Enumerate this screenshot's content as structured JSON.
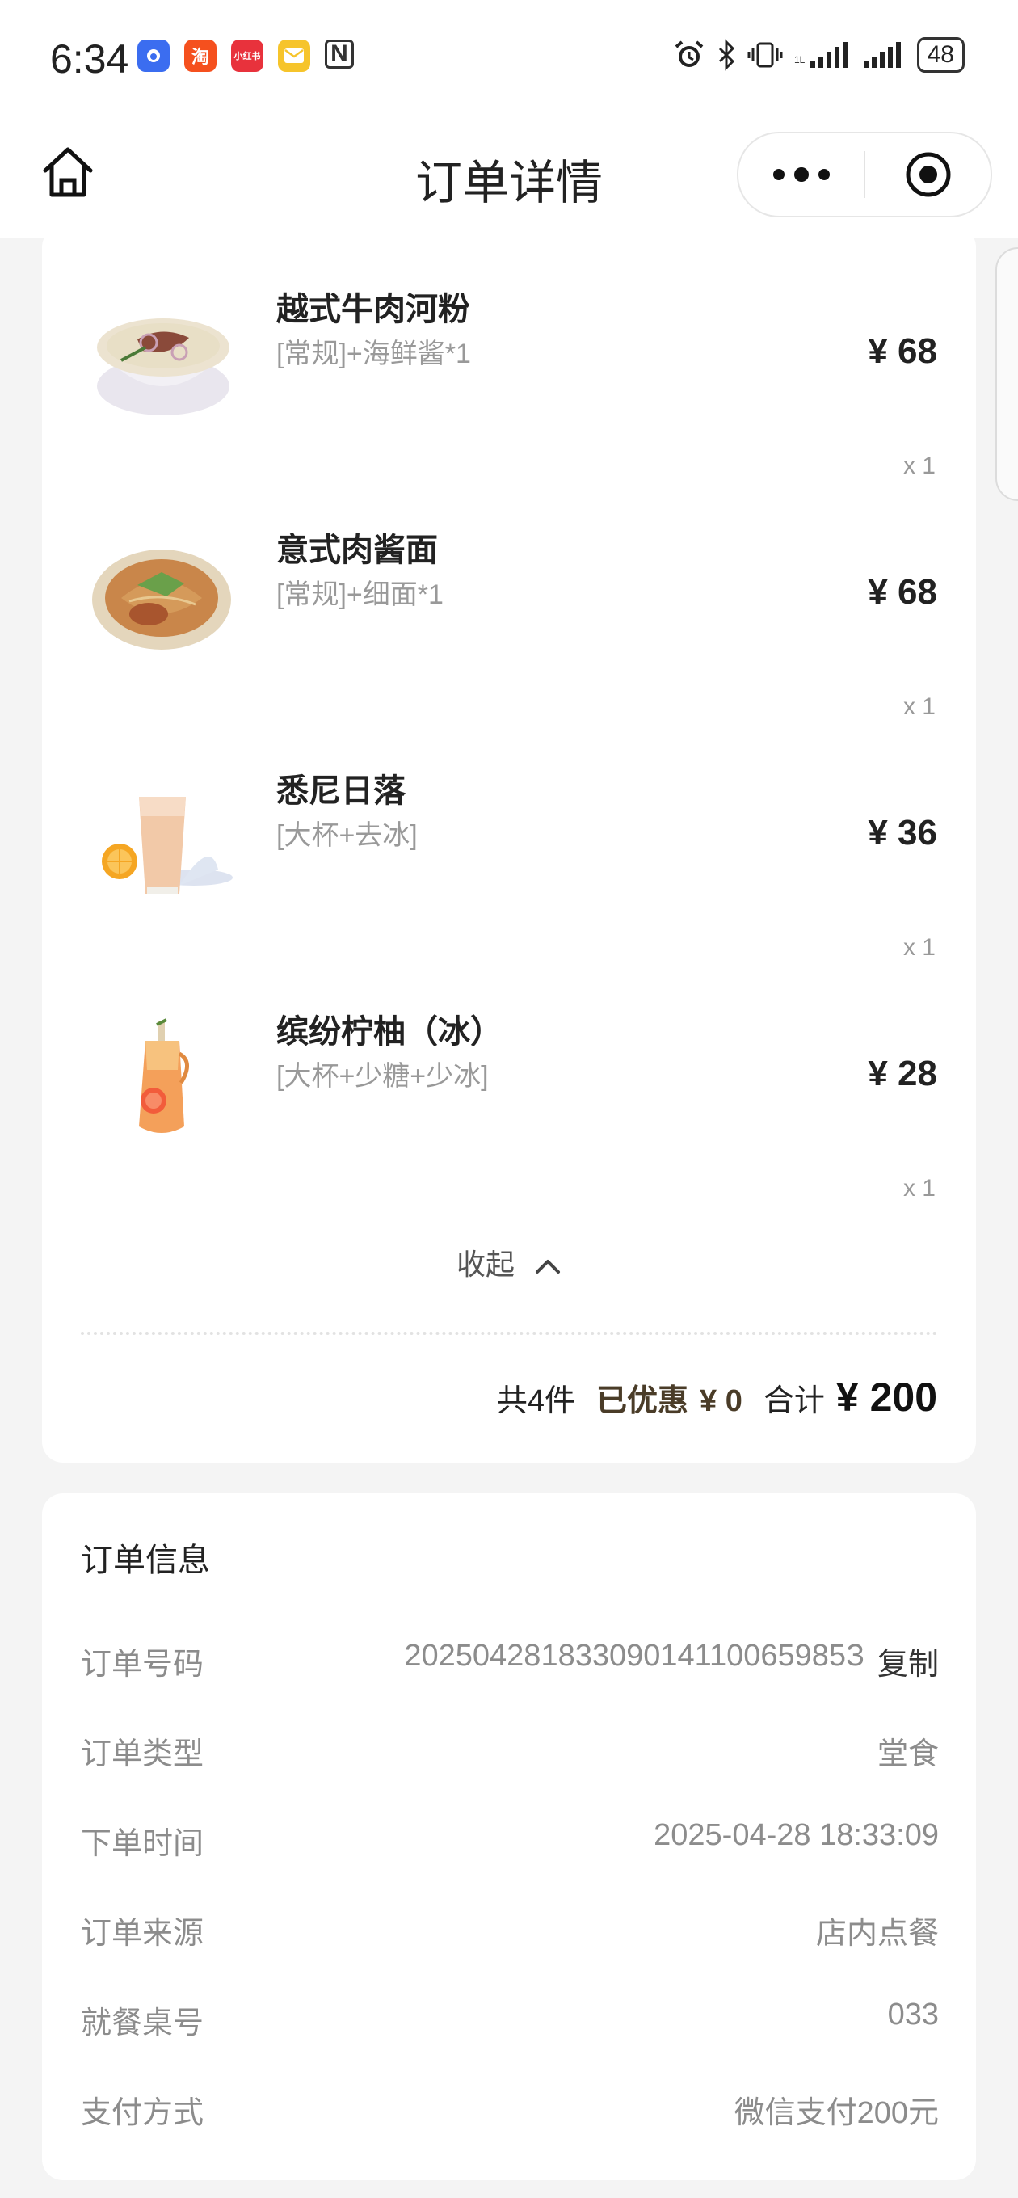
{
  "status_bar": {
    "time": "6:34",
    "battery": "48",
    "app_icons": [
      {
        "icon": "baidu-icon",
        "color": "#3b6df0",
        "label": ""
      },
      {
        "icon": "taobao-icon",
        "color": "#f5501e",
        "label": "淘"
      },
      {
        "icon": "xiaohongshu-icon",
        "color": "#e8323c",
        "label": "小红书"
      },
      {
        "icon": "mail-icon",
        "color": "#f6c42b",
        "label": ""
      },
      {
        "icon": "nfc-icon",
        "color": "#333333",
        "label": "N"
      }
    ]
  },
  "nav": {
    "title": "订单详情",
    "home_icon": "home-icon",
    "more_icon": "more-dots-icon",
    "close_icon": "target-close-icon"
  },
  "goods": {
    "items": [
      {
        "name": "越式牛肉河粉",
        "spec": "[常规]+海鲜酱*1",
        "price": "¥ 68",
        "qty": "x 1",
        "thumb": "beef-pho-image"
      },
      {
        "name": "意式肉酱面",
        "spec": "[常规]+细面*1",
        "price": "¥ 68",
        "qty": "x 1",
        "thumb": "bolognese-image"
      },
      {
        "name": "悉尼日落",
        "spec": "[大杯+去冰]",
        "price": "¥ 36",
        "qty": "x 1",
        "thumb": "sydney-sunset-drink-image"
      },
      {
        "name": "缤纷柠柚（冰）",
        "spec": "[大杯+少糖+少冰]",
        "price": "¥ 28",
        "qty": "x 1",
        "thumb": "lemon-grapefruit-drink-image"
      }
    ],
    "collapse_label": "收起",
    "summary": {
      "count": "共4件",
      "discount_label": "已优惠",
      "discount_value": "¥ 0",
      "total_label": "合计",
      "total_value": "¥ 200"
    }
  },
  "order_info": {
    "title": "订单信息",
    "copy_label": "复制",
    "rows": [
      {
        "label": "订单号码",
        "value": "20250428183309014110065985З"
      },
      {
        "label": "订单类型",
        "value": "堂食"
      },
      {
        "label": "下单时间",
        "value": "2025-04-28 18:33:09"
      },
      {
        "label": "订单来源",
        "value": "店内点餐"
      },
      {
        "label": "就餐桌号",
        "value": "033"
      },
      {
        "label": "支付方式",
        "value": "微信支付200元"
      }
    ]
  },
  "colors": {
    "background": "#f4f4f4",
    "card": "#ffffff",
    "discount": "#4a3c28",
    "muted": "#8c8c8c"
  }
}
